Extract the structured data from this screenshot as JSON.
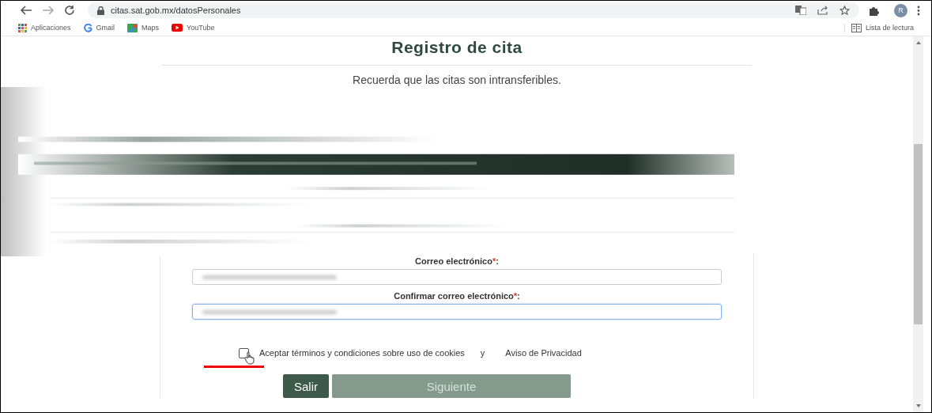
{
  "browser": {
    "url": "citas.sat.gob.mx/datosPersonales",
    "avatar": "R",
    "bookmarks": [
      {
        "label": "Aplicaciones",
        "kind": "apps"
      },
      {
        "label": "Gmail",
        "kind": "google"
      },
      {
        "label": "Maps",
        "kind": "maps"
      },
      {
        "label": "YouTube",
        "kind": "youtube"
      }
    ],
    "reading_list": "Lista de lectura"
  },
  "page": {
    "title": "Registro de cita",
    "subtitle": "Recuerda que las citas son intransferibles.",
    "fields": [
      {
        "label": "Correo electrónico",
        "required_mark": "*",
        "colon": ":",
        "focused": false
      },
      {
        "label": "Confirmar correo electrónico",
        "required_mark": "*",
        "colon": ":",
        "focused": true
      }
    ],
    "terms": {
      "checked": false,
      "text": "Aceptar términos y condiciones sobre uso de cookies",
      "connector": "y",
      "link": "Aviso de Privacidad"
    },
    "buttons": [
      {
        "label": "Salir",
        "disabled": false
      },
      {
        "label": "Siguiente",
        "disabled": true
      }
    ]
  }
}
